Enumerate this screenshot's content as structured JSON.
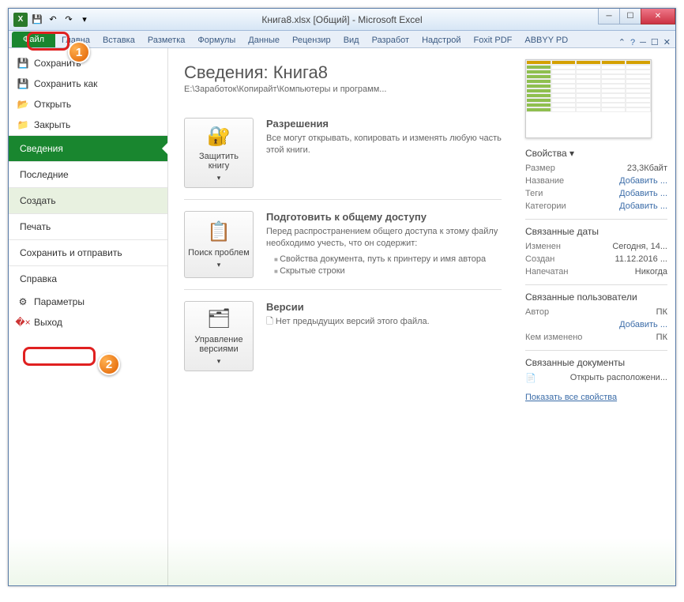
{
  "title": "Книга8.xlsx [Общий] - Microsoft Excel",
  "qat": {
    "save": "💾",
    "undo": "↶",
    "redo": "↷",
    "more": "▾"
  },
  "tabs": {
    "file": "Файл",
    "items": [
      "Главна",
      "Вставка",
      "Разметка",
      "Формулы",
      "Данные",
      "Рецензир",
      "Вид",
      "Разработ",
      "Надстрой",
      "Foxit PDF",
      "ABBYY PD"
    ]
  },
  "leftnav": {
    "save": "Сохранить",
    "saveas": "Сохранить как",
    "open": "Открыть",
    "close": "Закрыть",
    "info": "Сведения",
    "recent": "Последние",
    "new": "Создать",
    "print": "Печать",
    "sendshare": "Сохранить и отправить",
    "help": "Справка",
    "options": "Параметры",
    "exit": "Выход"
  },
  "info": {
    "heading": "Сведения: Книга8",
    "path": "E:\\Заработок\\Копирайт\\Компьютеры и программ...",
    "protect": {
      "btn": "Защитить книгу",
      "title": "Разрешения",
      "text": "Все могут открывать, копировать и изменять любую часть этой книги."
    },
    "prepare": {
      "btn": "Поиск проблем",
      "title": "Подготовить к общему доступу",
      "text": "Перед распространением общего доступа к этому файлу необходимо учесть, что он содержит:",
      "li1": "Свойства документа, путь к принтеру и имя автора",
      "li2": "Скрытые строки"
    },
    "versions": {
      "btn": "Управление версиями",
      "title": "Версии",
      "text": "Нет предыдущих версий этого файла."
    }
  },
  "props": {
    "head": "Свойства",
    "size_k": "Размер",
    "size_v": "23,3Кбайт",
    "name_k": "Название",
    "name_v": "Добавить ...",
    "tags_k": "Теги",
    "tags_v": "Добавить ...",
    "cat_k": "Категории",
    "cat_v": "Добавить ...",
    "dates_head": "Связанные даты",
    "mod_k": "Изменен",
    "mod_v": "Сегодня, 14...",
    "created_k": "Создан",
    "created_v": "11.12.2016 ...",
    "printed_k": "Напечатан",
    "printed_v": "Никогда",
    "users_head": "Связанные пользователи",
    "author_k": "Автор",
    "author_v": "ПК",
    "addauthor": "Добавить ...",
    "changed_k": "Кем изменено",
    "changed_v": "ПК",
    "docs_head": "Связанные документы",
    "openloc": "Открыть расположени...",
    "showall": "Показать все свойства"
  },
  "badges": {
    "one": "1",
    "two": "2"
  }
}
